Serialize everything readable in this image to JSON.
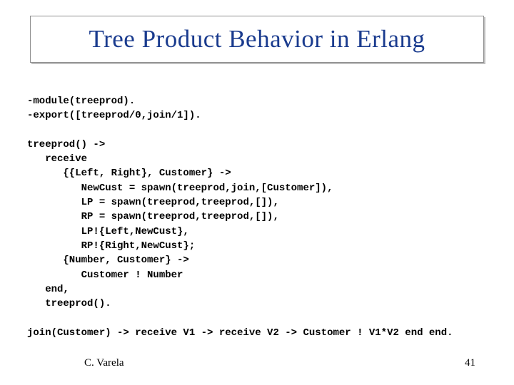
{
  "slide": {
    "title": "Tree Product Behavior in Erlang",
    "footer_author": "C. Varela",
    "footer_page": "41"
  },
  "code": {
    "lines": [
      "-module(treeprod).",
      "-export([treeprod/0,join/1]).",
      "",
      "treeprod() ->",
      "   receive",
      "      {{Left, Right}, Customer} ->",
      "         NewCust = spawn(treeprod,join,[Customer]),",
      "         LP = spawn(treeprod,treeprod,[]),",
      "         RP = spawn(treeprod,treeprod,[]),",
      "         LP!{Left,NewCust},",
      "         RP!{Right,NewCust};",
      "      {Number, Customer} ->",
      "         Customer ! Number",
      "   end,",
      "   treeprod().",
      "",
      "join(Customer) -> receive V1 -> receive V2 -> Customer ! V1*V2 end end."
    ]
  }
}
